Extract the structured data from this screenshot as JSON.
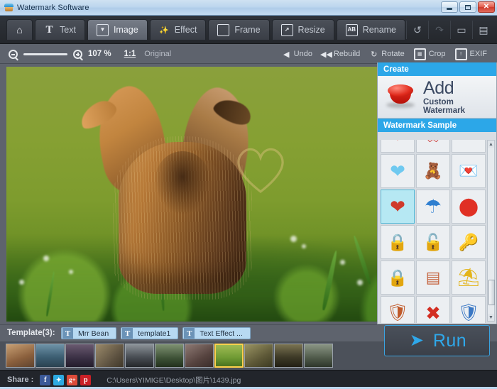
{
  "window": {
    "title": "Watermark Software",
    "icon": "app-icon",
    "controls": {
      "minimize": "–",
      "maximize": "□",
      "close": "✕"
    }
  },
  "tabs": [
    {
      "id": "home",
      "label": "",
      "icon": "home-icon",
      "active": false
    },
    {
      "id": "text",
      "label": "Text",
      "icon": "text-icon",
      "active": false
    },
    {
      "id": "image",
      "label": "Image",
      "icon": "image-icon",
      "active": true
    },
    {
      "id": "effect",
      "label": "Effect",
      "icon": "magic-wand-icon",
      "active": false
    },
    {
      "id": "frame",
      "label": "Frame",
      "icon": "frame-icon",
      "active": false
    },
    {
      "id": "resize",
      "label": "Resize",
      "icon": "resize-icon",
      "active": false
    },
    {
      "id": "rename",
      "label": "Rename",
      "icon": "rename-icon",
      "active": false
    }
  ],
  "titlebar_tools": [
    {
      "id": "undo",
      "icon": "undo-arrow-icon",
      "enabled": true
    },
    {
      "id": "redo",
      "icon": "redo-arrow-icon",
      "enabled": false
    },
    {
      "id": "feedback",
      "icon": "comment-icon",
      "enabled": true
    },
    {
      "id": "register",
      "icon": "register-doc-icon",
      "enabled": true
    }
  ],
  "subtoolbar": {
    "zoom_out_icon": "zoom-out-icon",
    "zoom_in_icon": "zoom-in-icon",
    "zoom_percent": "107 %",
    "one_to_one": "1:1",
    "original_label": "Original",
    "actions": [
      {
        "id": "undo",
        "label": "Undo",
        "icon": "undo-triangle-icon"
      },
      {
        "id": "rebuild",
        "label": "Rebuild",
        "icon": "rebuild-icon"
      },
      {
        "id": "rotate",
        "label": "Rotate",
        "icon": "rotate-icon"
      },
      {
        "id": "crop",
        "label": "Crop",
        "icon": "crop-icon"
      },
      {
        "id": "exif",
        "label": "EXIF",
        "icon": "exif-info-icon"
      }
    ]
  },
  "panel": {
    "create_header": "Create",
    "add_title": "Add",
    "add_subtitle": "Custom Watermark",
    "add_icon": "red-stamp-icon",
    "sample_header": "Watermark Sample",
    "samples": [
      {
        "id": "s01",
        "icon": "red-heart-down-icon",
        "glyph": "❤",
        "color": "#e03b2f",
        "selected": false,
        "partial": true
      },
      {
        "id": "s02",
        "icon": "red-ribbon-icon",
        "glyph": "🎗",
        "color": "#c9302c",
        "selected": false,
        "partial": true
      },
      {
        "id": "s03",
        "icon": "blank-icon",
        "glyph": "",
        "color": "#cccccc",
        "selected": false,
        "partial": true
      },
      {
        "id": "s04",
        "icon": "blue-bubble-heart-icon",
        "glyph": "❤",
        "color": "#6fc9f0",
        "selected": false
      },
      {
        "id": "s05",
        "icon": "teddy-bear-heart-icon",
        "glyph": "🧸",
        "color": "#c0392b",
        "selected": false
      },
      {
        "id": "s06",
        "icon": "love-letter-icon",
        "glyph": "💌",
        "color": "#e74c3c",
        "selected": false
      },
      {
        "id": "s07",
        "icon": "brush-heart-icon",
        "glyph": "❤",
        "color": "#cf3a2b",
        "selected": true
      },
      {
        "id": "s08",
        "icon": "blue-umbrella-icon",
        "glyph": "☂",
        "color": "#2f7fd0",
        "selected": false
      },
      {
        "id": "s09",
        "icon": "red-stamp-icon",
        "glyph": "●",
        "color": "#e03024",
        "selected": false
      },
      {
        "id": "s10",
        "icon": "gold-padlock-icon",
        "glyph": "🔒",
        "color": "#e3a23b",
        "selected": false
      },
      {
        "id": "s11",
        "icon": "blue-open-lock-icon",
        "glyph": "🔓",
        "color": "#2b8fd8",
        "selected": false
      },
      {
        "id": "s12",
        "icon": "gold-key-icon",
        "glyph": "🔑",
        "color": "#f0c killer",
        "selected": false
      },
      {
        "id": "s13",
        "icon": "silver-padlock-icon",
        "glyph": "🔒",
        "color": "#b9bec4",
        "selected": false
      },
      {
        "id": "s14",
        "icon": "brick-wall-icon",
        "glyph": "🧱",
        "color": "#c4603a",
        "selected": false
      },
      {
        "id": "s15",
        "icon": "beach-umbrella-icon",
        "glyph": "⛱",
        "color": "#e3b419",
        "selected": false
      },
      {
        "id": "s16",
        "icon": "striped-shield-icon",
        "glyph": "🛡",
        "color": "#c05a2a",
        "selected": false
      },
      {
        "id": "s17",
        "icon": "red-cross-icon",
        "glyph": "✖",
        "color": "#d32e22",
        "selected": false
      },
      {
        "id": "s18",
        "icon": "security-shield-icon",
        "glyph": "🛡",
        "color": "#3b78c4",
        "selected": false
      }
    ],
    "scroll_up_icon": "scroll-up-arrow-icon",
    "scroll_down_icon": "scroll-down-arrow-icon"
  },
  "template_bar": {
    "label": "Template(3):",
    "chips": [
      {
        "id": "t1",
        "label": "Mrr Bean",
        "icon": "text-template-icon"
      },
      {
        "id": "t2",
        "label": "template1",
        "icon": "text-template-icon"
      },
      {
        "id": "t3",
        "label": "Text Effect ...",
        "icon": "text-template-icon"
      }
    ],
    "icons": [
      {
        "id": "save-template",
        "icon": "save-disk-icon"
      },
      {
        "id": "manage-template",
        "icon": "manage-list-icon"
      }
    ]
  },
  "filmstrip": {
    "thumbnails": [
      {
        "id": "th1",
        "selected": false,
        "tint": "#a8784f"
      },
      {
        "id": "th2",
        "selected": false,
        "tint": "#4a6a80"
      },
      {
        "id": "th3",
        "selected": false,
        "tint": "#4b3f52"
      },
      {
        "id": "th4",
        "selected": false,
        "tint": "#6e6250"
      },
      {
        "id": "th5",
        "selected": false,
        "tint": "#5f6468"
      },
      {
        "id": "th6",
        "selected": false,
        "tint": "#4d6148"
      },
      {
        "id": "th7",
        "selected": false,
        "tint": "#6a5a58"
      },
      {
        "id": "th8",
        "selected": true,
        "tint": "#7aa33e"
      },
      {
        "id": "th9",
        "selected": false,
        "tint": "#6e6a45"
      },
      {
        "id": "th10",
        "selected": false,
        "tint": "#5a5640"
      },
      {
        "id": "th11",
        "selected": false,
        "tint": "#6a7468"
      }
    ],
    "run_label": "Run",
    "run_icon": "run-arrow-icon"
  },
  "statusbar": {
    "share_label": "Share :",
    "socials": [
      {
        "id": "facebook",
        "glyph": "f",
        "color": "#3b5998"
      },
      {
        "id": "twitter",
        "glyph": "t",
        "color": "#2daae1"
      },
      {
        "id": "googleplus",
        "glyph": "g+",
        "color": "#dd4b39"
      },
      {
        "id": "pinterest",
        "glyph": "p",
        "color": "#cb2027"
      }
    ],
    "file_path": "C:\\Users\\YIMIGE\\Desktop\\图片\\1439.jpg"
  },
  "canvas": {
    "image_name": "squirrel-photo",
    "watermark": "heart-outline-watermark"
  },
  "colors": {
    "accent_blue": "#2ca7e8",
    "run_blue": "#2fa8ea",
    "panel_bg": "#d8dde3",
    "toolbar_dark": "#2f333a",
    "subbar_gray": "#5e636d",
    "selection_yellow": "#ffd24d"
  }
}
